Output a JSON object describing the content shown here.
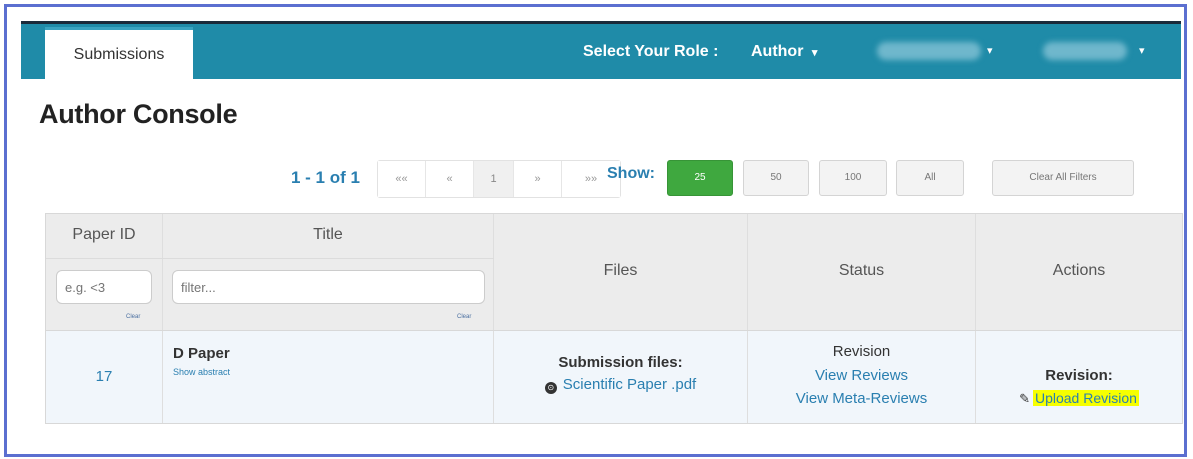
{
  "header": {
    "tab_label": "Submissions",
    "role_label": "Select Your Role :",
    "role_value": "Author",
    "caret": "▾"
  },
  "page": {
    "title": "Author Console"
  },
  "pager": {
    "count": "1 - 1 of 1",
    "first": "««",
    "prev": "«",
    "current": "1",
    "next": "»",
    "last": "»»",
    "show_label": "Show:",
    "sizes": [
      "25",
      "50",
      "100",
      "All"
    ],
    "active_size": "25",
    "clear_filters": "Clear All Filters"
  },
  "table": {
    "headers": {
      "paper_id": "Paper ID",
      "title": "Title",
      "files": "Files",
      "status": "Status",
      "actions": "Actions"
    },
    "filters": {
      "paper_id_placeholder": "e.g. <3",
      "title_placeholder": "filter...",
      "clear": "Clear"
    },
    "rows": [
      {
        "paper_id": "17",
        "title": "D Paper",
        "show_abstract": "Show abstract",
        "files_label": "Submission files:",
        "file_name": "Scientific Paper .pdf",
        "status": "Revision",
        "view_reviews": "View Reviews",
        "view_meta_reviews": "View Meta-Reviews",
        "action_label": "Revision:",
        "upload_revision": "Upload Revision"
      }
    ]
  }
}
